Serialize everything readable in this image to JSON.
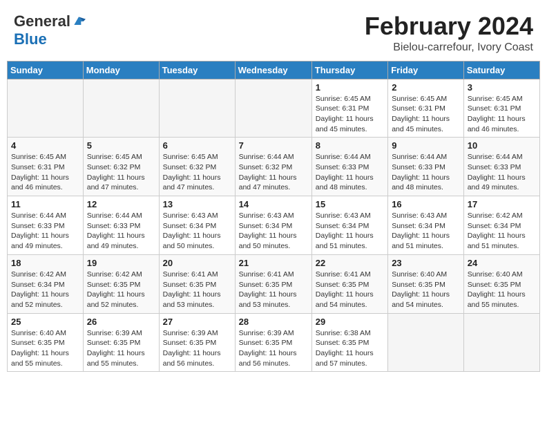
{
  "header": {
    "logo_general": "General",
    "logo_blue": "Blue",
    "month_title": "February 2024",
    "location": "Bielou-carrefour, Ivory Coast"
  },
  "days_of_week": [
    "Sunday",
    "Monday",
    "Tuesday",
    "Wednesday",
    "Thursday",
    "Friday",
    "Saturday"
  ],
  "weeks": [
    [
      {
        "day": "",
        "info": ""
      },
      {
        "day": "",
        "info": ""
      },
      {
        "day": "",
        "info": ""
      },
      {
        "day": "",
        "info": ""
      },
      {
        "day": "1",
        "info": "Sunrise: 6:45 AM\nSunset: 6:31 PM\nDaylight: 11 hours\nand 45 minutes."
      },
      {
        "day": "2",
        "info": "Sunrise: 6:45 AM\nSunset: 6:31 PM\nDaylight: 11 hours\nand 45 minutes."
      },
      {
        "day": "3",
        "info": "Sunrise: 6:45 AM\nSunset: 6:31 PM\nDaylight: 11 hours\nand 46 minutes."
      }
    ],
    [
      {
        "day": "4",
        "info": "Sunrise: 6:45 AM\nSunset: 6:31 PM\nDaylight: 11 hours\nand 46 minutes."
      },
      {
        "day": "5",
        "info": "Sunrise: 6:45 AM\nSunset: 6:32 PM\nDaylight: 11 hours\nand 47 minutes."
      },
      {
        "day": "6",
        "info": "Sunrise: 6:45 AM\nSunset: 6:32 PM\nDaylight: 11 hours\nand 47 minutes."
      },
      {
        "day": "7",
        "info": "Sunrise: 6:44 AM\nSunset: 6:32 PM\nDaylight: 11 hours\nand 47 minutes."
      },
      {
        "day": "8",
        "info": "Sunrise: 6:44 AM\nSunset: 6:33 PM\nDaylight: 11 hours\nand 48 minutes."
      },
      {
        "day": "9",
        "info": "Sunrise: 6:44 AM\nSunset: 6:33 PM\nDaylight: 11 hours\nand 48 minutes."
      },
      {
        "day": "10",
        "info": "Sunrise: 6:44 AM\nSunset: 6:33 PM\nDaylight: 11 hours\nand 49 minutes."
      }
    ],
    [
      {
        "day": "11",
        "info": "Sunrise: 6:44 AM\nSunset: 6:33 PM\nDaylight: 11 hours\nand 49 minutes."
      },
      {
        "day": "12",
        "info": "Sunrise: 6:44 AM\nSunset: 6:33 PM\nDaylight: 11 hours\nand 49 minutes."
      },
      {
        "day": "13",
        "info": "Sunrise: 6:43 AM\nSunset: 6:34 PM\nDaylight: 11 hours\nand 50 minutes."
      },
      {
        "day": "14",
        "info": "Sunrise: 6:43 AM\nSunset: 6:34 PM\nDaylight: 11 hours\nand 50 minutes."
      },
      {
        "day": "15",
        "info": "Sunrise: 6:43 AM\nSunset: 6:34 PM\nDaylight: 11 hours\nand 51 minutes."
      },
      {
        "day": "16",
        "info": "Sunrise: 6:43 AM\nSunset: 6:34 PM\nDaylight: 11 hours\nand 51 minutes."
      },
      {
        "day": "17",
        "info": "Sunrise: 6:42 AM\nSunset: 6:34 PM\nDaylight: 11 hours\nand 51 minutes."
      }
    ],
    [
      {
        "day": "18",
        "info": "Sunrise: 6:42 AM\nSunset: 6:34 PM\nDaylight: 11 hours\nand 52 minutes."
      },
      {
        "day": "19",
        "info": "Sunrise: 6:42 AM\nSunset: 6:35 PM\nDaylight: 11 hours\nand 52 minutes."
      },
      {
        "day": "20",
        "info": "Sunrise: 6:41 AM\nSunset: 6:35 PM\nDaylight: 11 hours\nand 53 minutes."
      },
      {
        "day": "21",
        "info": "Sunrise: 6:41 AM\nSunset: 6:35 PM\nDaylight: 11 hours\nand 53 minutes."
      },
      {
        "day": "22",
        "info": "Sunrise: 6:41 AM\nSunset: 6:35 PM\nDaylight: 11 hours\nand 54 minutes."
      },
      {
        "day": "23",
        "info": "Sunrise: 6:40 AM\nSunset: 6:35 PM\nDaylight: 11 hours\nand 54 minutes."
      },
      {
        "day": "24",
        "info": "Sunrise: 6:40 AM\nSunset: 6:35 PM\nDaylight: 11 hours\nand 55 minutes."
      }
    ],
    [
      {
        "day": "25",
        "info": "Sunrise: 6:40 AM\nSunset: 6:35 PM\nDaylight: 11 hours\nand 55 minutes."
      },
      {
        "day": "26",
        "info": "Sunrise: 6:39 AM\nSunset: 6:35 PM\nDaylight: 11 hours\nand 55 minutes."
      },
      {
        "day": "27",
        "info": "Sunrise: 6:39 AM\nSunset: 6:35 PM\nDaylight: 11 hours\nand 56 minutes."
      },
      {
        "day": "28",
        "info": "Sunrise: 6:39 AM\nSunset: 6:35 PM\nDaylight: 11 hours\nand 56 minutes."
      },
      {
        "day": "29",
        "info": "Sunrise: 6:38 AM\nSunset: 6:35 PM\nDaylight: 11 hours\nand 57 minutes."
      },
      {
        "day": "",
        "info": ""
      },
      {
        "day": "",
        "info": ""
      }
    ]
  ]
}
